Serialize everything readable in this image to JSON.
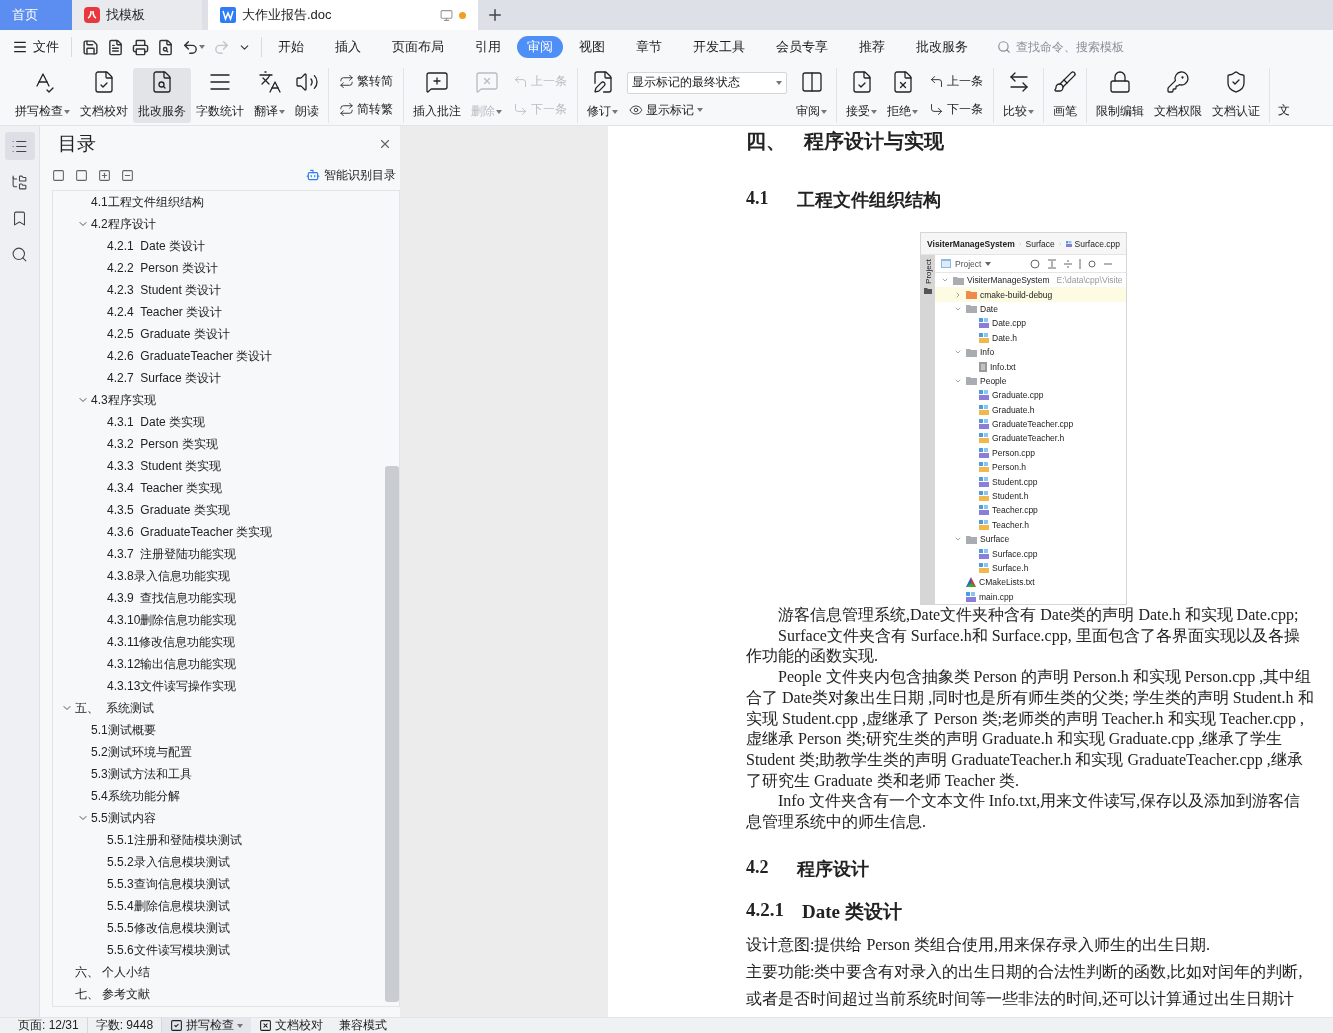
{
  "tabs": [
    {
      "label": "首页",
      "kind": "home",
      "selected": false
    },
    {
      "label": "找模板",
      "kind": "template",
      "selected": false
    },
    {
      "label": "大作业报告.doc",
      "kind": "document",
      "selected": true,
      "unsaved": true
    }
  ],
  "menu": {
    "file": "文件",
    "quick_access": [
      {
        "kind": "save",
        "disabled": false
      },
      {
        "kind": "export",
        "disabled": false
      },
      {
        "kind": "print",
        "disabled": false
      },
      {
        "kind": "preview",
        "disabled": false
      },
      {
        "kind": "undo",
        "disabled": false
      },
      {
        "kind": "redo",
        "disabled": true
      },
      {
        "kind": "more",
        "disabled": false
      }
    ],
    "items": [
      {
        "label": "开始",
        "selected": false
      },
      {
        "label": "插入",
        "selected": false
      },
      {
        "label": "页面布局",
        "selected": false
      },
      {
        "label": "引用",
        "selected": false
      },
      {
        "label": "审阅",
        "selected": true
      },
      {
        "label": "视图",
        "selected": false
      },
      {
        "label": "章节",
        "selected": false
      },
      {
        "label": "开发工具",
        "selected": false
      },
      {
        "label": "会员专享",
        "selected": false
      },
      {
        "label": "推荐",
        "selected": false
      },
      {
        "label": "批改服务",
        "selected": false
      }
    ],
    "search": {
      "placeholder": "查找命令、搜索模板"
    }
  },
  "ribbon": {
    "groups": [
      {
        "items": [
          {
            "kind": "large",
            "label": "拼写检查",
            "dropdown": true,
            "disabled": false,
            "highlighted": false
          },
          {
            "kind": "large",
            "label": "文档校对",
            "dropdown": false,
            "disabled": false,
            "highlighted": false
          },
          {
            "kind": "large",
            "label": "批改服务",
            "dropdown": false,
            "disabled": false,
            "highlighted": true
          },
          {
            "kind": "large",
            "label": "字数统计",
            "dropdown": false,
            "disabled": false,
            "highlighted": false
          },
          {
            "kind": "large",
            "label": "翻译",
            "dropdown": true,
            "disabled": false,
            "highlighted": false
          },
          {
            "kind": "large",
            "label": "朗读",
            "dropdown": false,
            "disabled": false,
            "highlighted": false
          }
        ]
      },
      {
        "items": [
          {
            "kind": "pair",
            "rows": [
              {
                "label": "繁转简",
                "disabled": false
              },
              {
                "label": "简转繁",
                "disabled": false
              }
            ]
          }
        ]
      },
      {
        "items": [
          {
            "kind": "large",
            "label": "插入批注",
            "dropdown": false,
            "disabled": false,
            "highlighted": false
          },
          {
            "kind": "large",
            "label": "删除",
            "dropdown": true,
            "disabled": true,
            "highlighted": false
          },
          {
            "kind": "pair",
            "rows": [
              {
                "label": "上一条",
                "disabled": true
              },
              {
                "label": "下一条",
                "disabled": true
              }
            ]
          }
        ]
      },
      {
        "items": [
          {
            "kind": "large",
            "label": "修订",
            "dropdown": true,
            "disabled": false,
            "highlighted": false
          },
          {
            "kind": "markup",
            "select": {
              "value": "显示标记的最终状态"
            },
            "button": {
              "label": "显示标记",
              "dropdown": true
            }
          },
          {
            "kind": "large",
            "label": "审阅",
            "dropdown": true,
            "disabled": false,
            "highlighted": false
          }
        ]
      },
      {
        "items": [
          {
            "kind": "large",
            "label": "接受",
            "dropdown": true,
            "disabled": false,
            "highlighted": false
          },
          {
            "kind": "large",
            "label": "拒绝",
            "dropdown": true,
            "disabled": false,
            "highlighted": false
          },
          {
            "kind": "pair",
            "rows": [
              {
                "label": "上一条",
                "disabled": false
              },
              {
                "label": "下一条",
                "disabled": false
              }
            ]
          }
        ]
      },
      {
        "items": [
          {
            "kind": "large",
            "label": "比较",
            "dropdown": true,
            "disabled": false,
            "highlighted": false
          }
        ]
      },
      {
        "items": [
          {
            "kind": "large",
            "label": "画笔",
            "dropdown": false,
            "disabled": false,
            "highlighted": false
          }
        ]
      },
      {
        "items": [
          {
            "kind": "large",
            "label": "限制编辑",
            "dropdown": false,
            "disabled": false,
            "highlighted": false
          },
          {
            "kind": "large",
            "label": "文档权限",
            "dropdown": false,
            "disabled": false,
            "highlighted": false
          },
          {
            "kind": "large",
            "label": "文档认证",
            "dropdown": false,
            "disabled": false,
            "highlighted": false
          }
        ]
      },
      {
        "items": [
          {
            "kind": "cut",
            "label": "文"
          }
        ]
      }
    ]
  },
  "nav_rail": [
    {
      "kind": "outline",
      "selected": true
    },
    {
      "kind": "files",
      "selected": false
    },
    {
      "kind": "bookmarks",
      "selected": false
    },
    {
      "kind": "search",
      "selected": false
    }
  ],
  "toc": {
    "title": "目录",
    "smart_link": "智能识别目录",
    "continued": [
      {
        "label": "4.1工程文件组织结构"
      },
      {
        "label": "4.2程序设计",
        "expanded": true,
        "children": [
          {
            "label": "4.2.1  Date 类设计"
          },
          {
            "label": "4.2.2  Person 类设计"
          },
          {
            "label": "4.2.3  Student 类设计"
          },
          {
            "label": "4.2.4  Teacher 类设计"
          },
          {
            "label": "4.2.5  Graduate 类设计"
          },
          {
            "label": "4.2.6  GraduateTeacher 类设计"
          },
          {
            "label": "4.2.7  Surface 类设计"
          }
        ]
      },
      {
        "label": "4.3程序实现",
        "expanded": true,
        "children": [
          {
            "label": "4.3.1  Date 类实现"
          },
          {
            "label": "4.3.2  Person 类实现"
          },
          {
            "label": "4.3.3  Student 类实现"
          },
          {
            "label": "4.3.4  Teacher 类实现"
          },
          {
            "label": "4.3.5  Graduate 类实现"
          },
          {
            "label": "4.3.6  GraduateTeacher 类实现"
          },
          {
            "label": "4.3.7  注册登陆功能实现"
          },
          {
            "label": "4.3.8录入信息功能实现"
          },
          {
            "label": "4.3.9  查找信息功能实现"
          },
          {
            "label": "4.3.10删除信息功能实现"
          },
          {
            "label": "4.3.11修改信息功能实现"
          },
          {
            "label": "4.3.12输出信息功能实现"
          },
          {
            "label": "4.3.13文件读写操作实现"
          }
        ]
      }
    ],
    "items": [
      {
        "label": "五、  系统测试",
        "expanded": true,
        "children": [
          {
            "label": "5.1测试概要"
          },
          {
            "label": "5.2测试环境与配置"
          },
          {
            "label": "5.3测试方法和工具"
          },
          {
            "label": "5.4系统功能分解"
          },
          {
            "label": "5.5测试内容",
            "expanded": true,
            "children": [
              {
                "label": "5.5.1注册和登陆模块测试"
              },
              {
                "label": "5.5.2录入信息模块测试"
              },
              {
                "label": "5.5.3查询信息模块测试"
              },
              {
                "label": "5.5.4删除信息模块测试"
              },
              {
                "label": "5.5.5修改信息模块测试"
              },
              {
                "label": "5.5.6文件读写模块测试"
              }
            ]
          }
        ]
      },
      {
        "label": "六、 个人小结"
      },
      {
        "label": "七、 参考文献"
      }
    ]
  },
  "document": {
    "blocks": [
      {
        "kind": "h1",
        "number": "四、",
        "title": "程序设计与实现"
      },
      {
        "kind": "h2",
        "number": "4.1",
        "title": "工程文件组织结构"
      },
      {
        "kind": "figure",
        "screenshot": {
          "breadcrumb": [
            "VisiterManageSystem",
            "Surface",
            "Surface.cpp"
          ],
          "side_tab": "Project",
          "view_select": "Project",
          "tree": [
            {
              "name": "VisiterManageSystem",
              "path": "E:\\data\\cpp\\Visite",
              "kind": "folder",
              "expanded": true,
              "children": [
                {
                  "name": "cmake-build-debug",
                  "kind": "excluded",
                  "expanded": false
                },
                {
                  "name": "Date",
                  "kind": "folder",
                  "expanded": true,
                  "children": [
                    {
                      "name": "Date.cpp",
                      "kind": "cpp"
                    },
                    {
                      "name": "Date.h",
                      "kind": "h"
                    }
                  ]
                },
                {
                  "name": "Info",
                  "kind": "folder",
                  "expanded": true,
                  "children": [
                    {
                      "name": "Info.txt",
                      "kind": "txt"
                    }
                  ]
                },
                {
                  "name": "People",
                  "kind": "folder",
                  "expanded": true,
                  "children": [
                    {
                      "name": "Graduate.cpp",
                      "kind": "cpp"
                    },
                    {
                      "name": "Graduate.h",
                      "kind": "h"
                    },
                    {
                      "name": "GraduateTeacher.cpp",
                      "kind": "cpp"
                    },
                    {
                      "name": "GraduateTeacher.h",
                      "kind": "h"
                    },
                    {
                      "name": "Person.cpp",
                      "kind": "cpp"
                    },
                    {
                      "name": "Person.h",
                      "kind": "h"
                    },
                    {
                      "name": "Student.cpp",
                      "kind": "cpp"
                    },
                    {
                      "name": "Student.h",
                      "kind": "h"
                    },
                    {
                      "name": "Teacher.cpp",
                      "kind": "cpp"
                    },
                    {
                      "name": "Teacher.h",
                      "kind": "h"
                    }
                  ]
                },
                {
                  "name": "Surface",
                  "kind": "folder",
                  "expanded": true,
                  "children": [
                    {
                      "name": "Surface.cpp",
                      "kind": "cpp"
                    },
                    {
                      "name": "Surface.h",
                      "kind": "h"
                    }
                  ]
                },
                {
                  "name": "CMakeLists.txt",
                  "kind": "cmake"
                },
                {
                  "name": "main.cpp",
                  "kind": "cpp"
                }
              ]
            }
          ]
        }
      },
      {
        "kind": "para",
        "text": "游客信息管理系统,Date文件夹种含有 Date类的声明 Date.h 和实现 Date.cpp;"
      },
      {
        "kind": "para",
        "text": "Surface文件夹含有 Surface.h和 Surface.cpp, 里面包含了各界面实现以及各操作功能的函数实现."
      },
      {
        "kind": "para",
        "text": "People 文件夹内包含抽象类 Person 的声明 Person.h 和实现 Person.cpp ,其中组合了 Date类对象出生日期 ,同时也是所有师生类的父类; 学生类的声明 Student.h 和实现 Student.cpp ,虚继承了 Person 类;老师类的声明 Teacher.h 和实现 Teacher.cpp ,虚继承 Person 类;研究生类的声明 Graduate.h 和实现 Graduate.cpp ,继承了学生 Student 类;助教学生类的声明 GraduateTeacher.h 和实现 GraduateTeacher.cpp ,继承了研究生 Graduate 类和老师 Teacher 类."
      },
      {
        "kind": "para",
        "text": "Info 文件夹含有一个文本文件 Info.txt,用来文件读写,保存以及添加到游客信息管理系统中的师生信息."
      },
      {
        "kind": "h2",
        "number": "4.2",
        "title": "程序设计"
      },
      {
        "kind": "h3",
        "number": "4.2.1",
        "title": "Date 类设计"
      },
      {
        "kind": "body",
        "text": "设计意图:提供给 Person 类组合使用,用来保存录入师生的出生日期."
      },
      {
        "kind": "body",
        "text": "主要功能:类中要含有对录入的出生日期的合法性判断的函数,比如对闰年的判断,"
      },
      {
        "kind": "body",
        "text": "或者是否时间超过当前系统时间等一些非法的时间,还可以计算通过出生日期计"
      }
    ]
  },
  "status_bar": {
    "page": "页面: 12/31",
    "words": "字数: 9448",
    "items": [
      {
        "kind": "spell",
        "label": "拼写检查",
        "dropdown": true,
        "highlighted": true
      },
      {
        "kind": "proof",
        "label": "文档校对",
        "dropdown": false,
        "highlighted": false
      },
      {
        "kind": "plain",
        "label": "兼容模式",
        "dropdown": false,
        "highlighted": false
      }
    ]
  }
}
